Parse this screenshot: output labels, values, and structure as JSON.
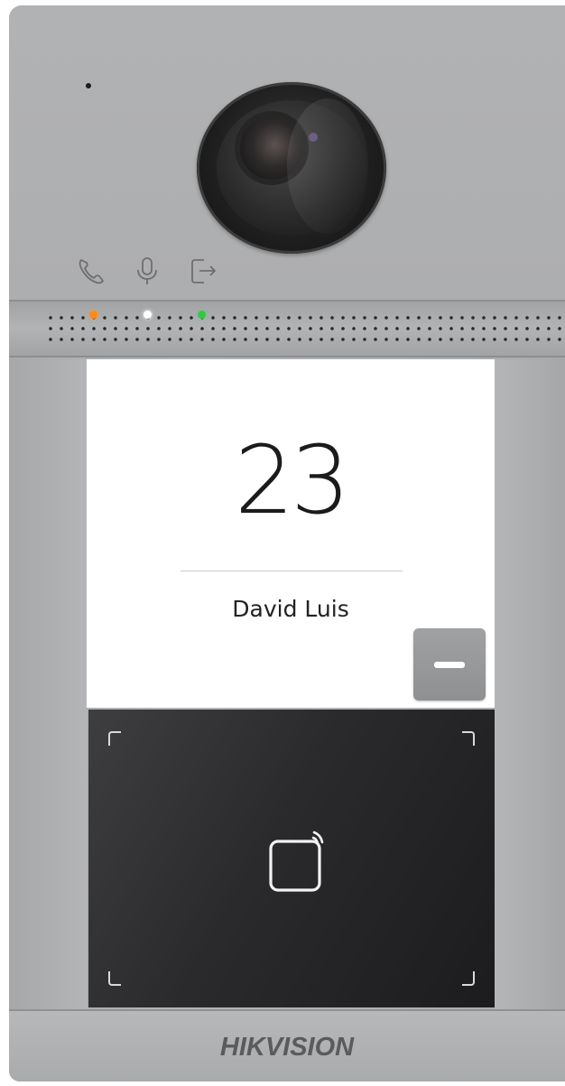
{
  "display": {
    "room_number": "23",
    "resident_name": "David Luis"
  },
  "branding": {
    "logo_text": "HIKVISION"
  },
  "indicators": {
    "call_icon": "phone-icon",
    "mic_icon": "microphone-icon",
    "door_icon": "door-exit-icon",
    "led_colors": [
      "#ff8a1a",
      "#ffffff",
      "#39c447"
    ]
  },
  "card_reader": {
    "icon": "nfc-card-icon"
  }
}
